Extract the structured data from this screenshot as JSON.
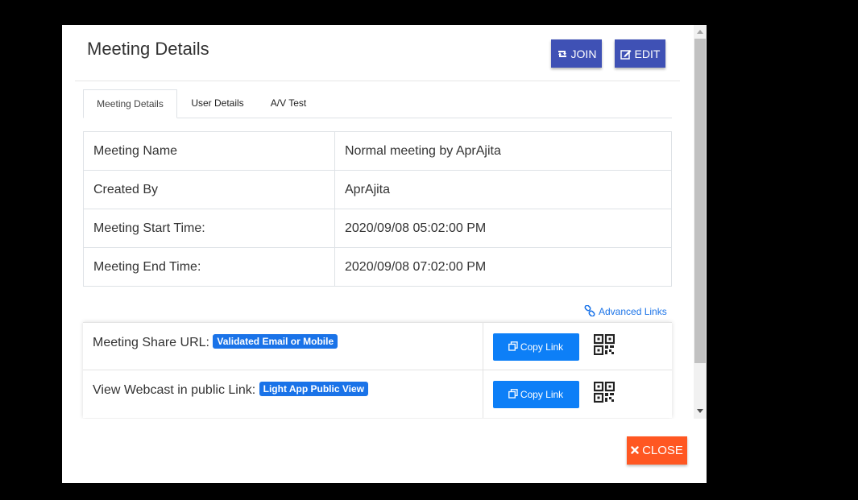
{
  "header": {
    "title": "Meeting Details",
    "join_label": "JOIN",
    "edit_label": "EDIT"
  },
  "tabs": [
    {
      "label": "Meeting Details",
      "active": true
    },
    {
      "label": "User Details",
      "active": false
    },
    {
      "label": "A/V Test",
      "active": false
    }
  ],
  "details": [
    {
      "key": "Meeting Name",
      "value": "Normal meeting by AprAjita"
    },
    {
      "key": "Created By",
      "value": "AprAjita"
    },
    {
      "key": "Meeting Start Time:",
      "value": "2020/09/08 05:02:00 PM"
    },
    {
      "key": "Meeting End Time:",
      "value": "2020/09/08 07:02:00 PM"
    }
  ],
  "advanced_links_label": "Advanced Links",
  "share_rows": [
    {
      "label": "Meeting Share URL:",
      "badge": "Validated Email or Mobile",
      "copy_label": "Copy Link"
    },
    {
      "label": "View Webcast in public Link:",
      "badge": "Light App Public View",
      "copy_label": "Copy Link"
    }
  ],
  "footer": {
    "close_label": "CLOSE"
  },
  "icons": {
    "join": "retweet-icon",
    "edit": "edit-icon",
    "link": "link-icon",
    "copy": "copy-icon",
    "qr": "qrcode-icon",
    "close": "times-icon"
  },
  "colors": {
    "primary_button": "#3f51b5",
    "copy_button": "#0d7ff7",
    "badge": "#1a73e8",
    "close_button": "#ff5722",
    "backdrop": "#000000"
  }
}
